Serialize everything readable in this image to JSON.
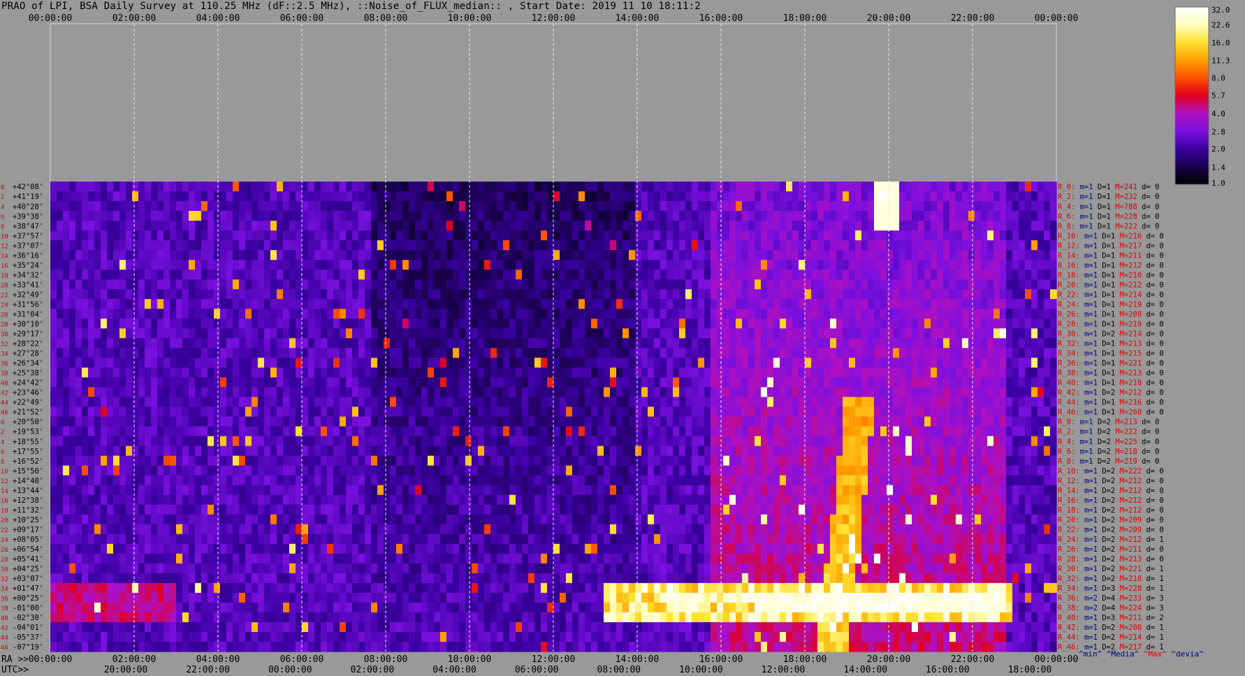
{
  "title": "PRAO of LPI, BSA Daily Survey at 110.25 MHz (dF::2.5 MHz), ::Noise_of_FLUX_median:: , Start Date: 2019 11 10 18:11:2",
  "chart_data": {
    "type": "heatmap",
    "top_time_ticks": [
      "00:00:00",
      "02:00:00",
      "04:00:00",
      "06:00:00",
      "08:00:00",
      "10:00:00",
      "12:00:00",
      "14:00:00",
      "16:00:00",
      "18:00:00",
      "20:00:00",
      "22:00:00",
      "00:00:00"
    ],
    "ra_ticks": [
      "00:00:00",
      "02:00:00",
      "04:00:00",
      "06:00:00",
      "08:00:00",
      "10:00:00",
      "12:00:00",
      "14:00:00",
      "16:00:00",
      "18:00:00",
      "20:00:00",
      "22:00:00",
      "00:00:00"
    ],
    "utc_ticks": [
      "20:00:00",
      "22:00:00",
      "00:00:00",
      "02:00:00",
      "04:00:00",
      "06:00:00",
      "08:00:00",
      "10:00:00",
      "12:00:00",
      "14:00:00",
      "16:00:00",
      "18:00:00"
    ],
    "ra_prefix": "RA >>",
    "utc_prefix": "UTC>>",
    "declinations": [
      "+42°08'",
      "+41°19'",
      "+40°28'",
      "+39°38'",
      "+38°47'",
      "+37°57'",
      "+37°07'",
      "+36°16'",
      "+35°24'",
      "+34°32'",
      "+33°41'",
      "+32°49'",
      "+31°56'",
      "+31°04'",
      "+30°10'",
      "+29°17'",
      "+28°22'",
      "+27°28'",
      "+26°34'",
      "+25°38'",
      "+24°42'",
      "+23°46'",
      "+22°49'",
      "+21°52'",
      "+20°50'",
      "+19°53'",
      "+18°55'",
      "+17°55'",
      "+16°52'",
      "+15°50'",
      "+14°48'",
      "+13°44'",
      "+12°38'",
      "+11°32'",
      "+10°25'",
      "+09°17'",
      "+08°05'",
      "+06°54'",
      "+05°41'",
      "+04°25'",
      "+03°07'",
      "+01°47'",
      "+00°25'",
      "-01°00'",
      "-02°30'",
      "-04°01'",
      "-05°37'",
      "-07°19'"
    ],
    "row_index_labels": [
      "0",
      "2",
      "4",
      "6",
      "8",
      "10",
      "12",
      "14",
      "16",
      "18",
      "20",
      "22",
      "24",
      "26",
      "28",
      "30",
      "32",
      "34",
      "36",
      "38",
      "40",
      "42",
      "44",
      "46",
      "0",
      "2",
      "4",
      "6",
      "8",
      "10",
      "12",
      "14",
      "16",
      "18",
      "20",
      "22",
      "24",
      "26",
      "28",
      "30",
      "32",
      "34",
      "36",
      "38",
      "40",
      "42",
      "44",
      "46"
    ],
    "ray_stats": [
      {
        "r": "R_0:",
        "m": "m=1",
        "D": "D=1",
        "M": "M=241",
        "d": "d= 0"
      },
      {
        "r": "R_2:",
        "m": "m=1",
        "D": "D=1",
        "M": "M=232",
        "d": "d= 0"
      },
      {
        "r": "R_4:",
        "m": "m=1",
        "D": "D=1",
        "M": "M=788",
        "d": "d= 0"
      },
      {
        "r": "R_6:",
        "m": "m=1",
        "D": "D=1",
        "M": "M=228",
        "d": "d= 0"
      },
      {
        "r": "R_8:",
        "m": "m=1",
        "D": "D=1",
        "M": "M=222",
        "d": "d= 0"
      },
      {
        "r": "R_10:",
        "m": "m=1",
        "D": "D=1",
        "M": "M=216",
        "d": "d= 0"
      },
      {
        "r": "R_12:",
        "m": "m=1",
        "D": "D=1",
        "M": "M=217",
        "d": "d= 0"
      },
      {
        "r": "R_14:",
        "m": "m=1",
        "D": "D=1",
        "M": "M=211",
        "d": "d= 0"
      },
      {
        "r": "R_16:",
        "m": "m=1",
        "D": "D=1",
        "M": "M=212",
        "d": "d= 0"
      },
      {
        "r": "R_18:",
        "m": "m=1",
        "D": "D=1",
        "M": "M=210",
        "d": "d= 0"
      },
      {
        "r": "R_20:",
        "m": "m=1",
        "D": "D=1",
        "M": "M=212",
        "d": "d= 0"
      },
      {
        "r": "R_22:",
        "m": "m=1",
        "D": "D=1",
        "M": "M=214",
        "d": "d= 0"
      },
      {
        "r": "R_24:",
        "m": "m=1",
        "D": "D=1",
        "M": "M=219",
        "d": "d= 0"
      },
      {
        "r": "R_26:",
        "m": "m=1",
        "D": "D=1",
        "M": "M=208",
        "d": "d= 0"
      },
      {
        "r": "R_28:",
        "m": "m=1",
        "D": "D=1",
        "M": "M=219",
        "d": "d= 0"
      },
      {
        "r": "R_30:",
        "m": "m=1",
        "D": "D=2",
        "M": "M=214",
        "d": "d= 0"
      },
      {
        "r": "R_32:",
        "m": "m=1",
        "D": "D=1",
        "M": "M=213",
        "d": "d= 0"
      },
      {
        "r": "R_34:",
        "m": "m=1",
        "D": "D=1",
        "M": "M=215",
        "d": "d= 0"
      },
      {
        "r": "R_36:",
        "m": "m=1",
        "D": "D=1",
        "M": "M=221",
        "d": "d= 0"
      },
      {
        "r": "R_38:",
        "m": "m=1",
        "D": "D=1",
        "M": "M=213",
        "d": "d= 0"
      },
      {
        "r": "R_40:",
        "m": "m=1",
        "D": "D=1",
        "M": "M=218",
        "d": "d= 0"
      },
      {
        "r": "R_42:",
        "m": "m=1",
        "D": "D=2",
        "M": "M=212",
        "d": "d= 0"
      },
      {
        "r": "R_44:",
        "m": "m=1",
        "D": "D=1",
        "M": "M=216",
        "d": "d= 0"
      },
      {
        "r": "R_46:",
        "m": "m=1",
        "D": "D=1",
        "M": "M=260",
        "d": "d= 0"
      },
      {
        "r": "R_0:",
        "m": "m=1",
        "D": "D=2",
        "M": "M=213",
        "d": "d= 0"
      },
      {
        "r": "R_2:",
        "m": "m=1",
        "D": "D=2",
        "M": "M=222",
        "d": "d= 0"
      },
      {
        "r": "R_4:",
        "m": "m=1",
        "D": "D=2",
        "M": "M=225",
        "d": "d= 0"
      },
      {
        "r": "R_6:",
        "m": "m=1",
        "D": "D=2",
        "M": "M=218",
        "d": "d= 0"
      },
      {
        "r": "R_8:",
        "m": "m=1",
        "D": "D=2",
        "M": "M=219",
        "d": "d= 0"
      },
      {
        "r": "R_10:",
        "m": "m=1",
        "D": "D=2",
        "M": "M=222",
        "d": "d= 0"
      },
      {
        "r": "R_12:",
        "m": "m=1",
        "D": "D=2",
        "M": "M=212",
        "d": "d= 0"
      },
      {
        "r": "R_14:",
        "m": "m=1",
        "D": "D=2",
        "M": "M=212",
        "d": "d= 0"
      },
      {
        "r": "R_16:",
        "m": "m=1",
        "D": "D=2",
        "M": "M=212",
        "d": "d= 0"
      },
      {
        "r": "R_18:",
        "m": "m=1",
        "D": "D=2",
        "M": "M=212",
        "d": "d= 0"
      },
      {
        "r": "R_20:",
        "m": "m=1",
        "D": "D=2",
        "M": "M=209",
        "d": "d= 0"
      },
      {
        "r": "R_22:",
        "m": "m=1",
        "D": "D=2",
        "M": "M=209",
        "d": "d= 0"
      },
      {
        "r": "R_24:",
        "m": "m=1",
        "D": "D=2",
        "M": "M=212",
        "d": "d= 1"
      },
      {
        "r": "R_26:",
        "m": "m=1",
        "D": "D=2",
        "M": "M=211",
        "d": "d= 0"
      },
      {
        "r": "R_28:",
        "m": "m=1",
        "D": "D=2",
        "M": "M=213",
        "d": "d= 0"
      },
      {
        "r": "R_30:",
        "m": "m=1",
        "D": "D=2",
        "M": "M=221",
        "d": "d= 1"
      },
      {
        "r": "R_32:",
        "m": "m=1",
        "D": "D=2",
        "M": "M=218",
        "d": "d= 1"
      },
      {
        "r": "R_34:",
        "m": "m=1",
        "D": "D=3",
        "M": "M=228",
        "d": "d= 1"
      },
      {
        "r": "R_36:",
        "m": "m=2",
        "D": "D=4",
        "M": "M=233",
        "d": "d= 3"
      },
      {
        "r": "R_38:",
        "m": "m=2",
        "D": "D=4",
        "M": "M=224",
        "d": "d= 3"
      },
      {
        "r": "R_40:",
        "m": "m=1",
        "D": "D=3",
        "M": "M=211",
        "d": "d= 2"
      },
      {
        "r": "R_42:",
        "m": "m=1",
        "D": "D=2",
        "M": "M=208",
        "d": "d= 1"
      },
      {
        "r": "R_44:",
        "m": "m=1",
        "D": "D=2",
        "M": "M=214",
        "d": "d= 1"
      },
      {
        "r": "R_46:",
        "m": "m=1",
        "D": "D=2",
        "M": "M=217",
        "d": "d= 1"
      }
    ],
    "stats_legend": [
      {
        "text": "^min^",
        "color": "#000080"
      },
      {
        "text": "^Media^",
        "color": "#000080"
      },
      {
        "text": "^Max^",
        "color": "#e00000"
      },
      {
        "text": "^devia^",
        "color": "#000080"
      }
    ],
    "colorbar_ticks": [
      "32.0",
      "22.6",
      "16.0",
      "11.3",
      "8.0",
      "5.7",
      "4.0",
      "2.8",
      "2.0",
      "1.4",
      "1.0"
    ],
    "colorbar_range": [
      1.0,
      32.0
    ],
    "colorbar_scale": "log",
    "colormap_stops": [
      "#000000",
      "#1a0050",
      "#3a00a0",
      "#7a10e0",
      "#b010c0",
      "#e00020",
      "#ff5000",
      "#ffa000",
      "#ffe030",
      "#ffffc0",
      "#ffffff"
    ],
    "colors": {
      "background": "#999999",
      "stat_red": "#e00000",
      "stat_blue": "#000080",
      "dec_label": "#000000",
      "index_label": "#e00000"
    }
  }
}
